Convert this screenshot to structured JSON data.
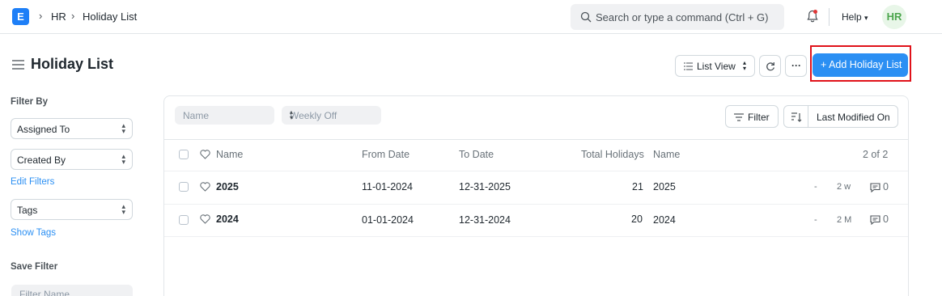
{
  "navbar": {
    "logo_letter": "E",
    "breadcrumbs": [
      "HR",
      "Holiday List"
    ],
    "search_placeholder": "Search or type a command (Ctrl + G)",
    "help_label": "Help",
    "avatar_initials": "HR"
  },
  "page": {
    "title": "Holiday List",
    "list_view_label": "List View",
    "more_label": "···",
    "add_button_label": "+ Add Holiday List"
  },
  "sidebar": {
    "filter_by_label": "Filter By",
    "assigned_to_label": "Assigned To",
    "created_by_label": "Created By",
    "edit_filters_label": "Edit Filters",
    "tags_label": "Tags",
    "show_tags_label": "Show Tags",
    "save_filter_label": "Save Filter",
    "filter_name_placeholder": "Filter Name"
  },
  "list": {
    "name_filter_placeholder": "Name",
    "weekly_off_placeholder": "Weekly Off",
    "filter_button_label": "Filter",
    "sort_label": "Last Modified On",
    "columns": [
      "Name",
      "From Date",
      "To Date",
      "Total Holidays",
      "Name"
    ],
    "count_label": "2 of 2",
    "rows": [
      {
        "name": "2025",
        "from_date": "11-01-2024",
        "to_date": "12-31-2025",
        "total_holidays": "21",
        "name2": "2025",
        "dash": "-",
        "modified": "2 w",
        "comments": "0"
      },
      {
        "name": "2024",
        "from_date": "01-01-2024",
        "to_date": "12-31-2024",
        "total_holidays": "20",
        "name2": "2024",
        "dash": "-",
        "modified": "2 M",
        "comments": "0"
      }
    ]
  },
  "colors": {
    "primary": "#2b8ff3",
    "highlight_border": "#e0121a",
    "avatar_bg": "#e8f6e8",
    "avatar_fg": "#4ba54c"
  }
}
